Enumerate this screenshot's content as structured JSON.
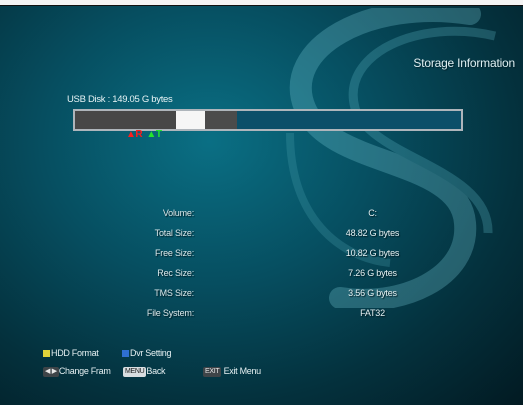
{
  "title": "Storage Information",
  "disk": {
    "label": "USB Disk : 149.05 G bytes"
  },
  "usage_bar": {
    "rec_fraction": 0.26,
    "tms_fraction": 0.074,
    "rec_tail_fraction": 0.082,
    "markers": {
      "rec": "R",
      "tms": "T"
    },
    "colors": {
      "rec": "#474747",
      "tms": "#f6f6f6",
      "free": "#0b4f69"
    }
  },
  "info": {
    "volume": {
      "label": "Volume:",
      "value": "C:"
    },
    "total": {
      "label": "Total Size:",
      "value": "48.82 G bytes"
    },
    "free": {
      "label": "Free Size:",
      "value": "10.82 G bytes"
    },
    "rec": {
      "label": "Rec Size:",
      "value": "7.26 G bytes"
    },
    "tms": {
      "label": "TMS Size:",
      "value": "3.56 G bytes"
    },
    "fs": {
      "label": "File System:",
      "value": "FAT32"
    }
  },
  "legend": {
    "hdd_format": "HDD Format",
    "dvr_setting": "Dvr Setting",
    "change_frame": "Change Fram",
    "menu_key": "MENU",
    "back": "Back",
    "exit_key": "EXIT",
    "exit_menu": "Exit Menu",
    "colors": {
      "yellow": "#e0d23a",
      "blue": "#2f6fd0"
    }
  }
}
